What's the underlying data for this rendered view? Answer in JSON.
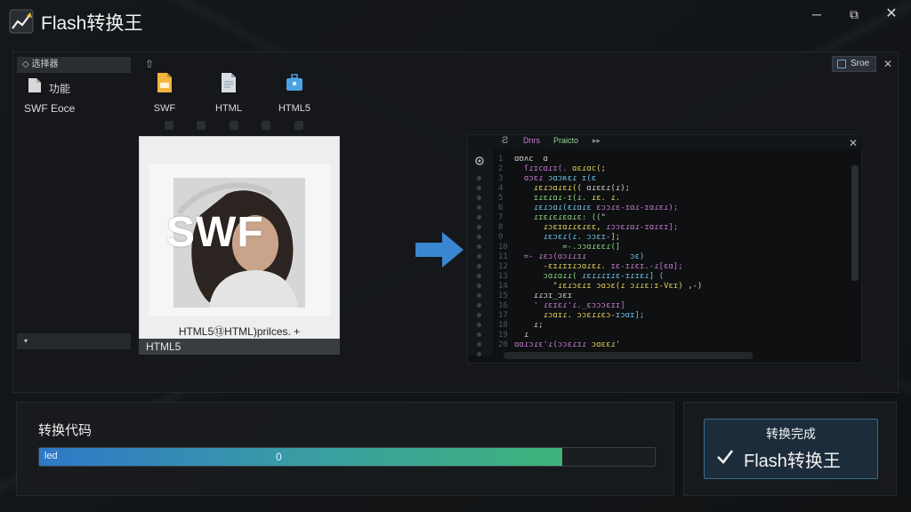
{
  "window": {
    "title": "Flash转换王",
    "controls": {
      "minimize": "─",
      "maximize": "⧉",
      "close": "✕"
    }
  },
  "sidebar": {
    "header": "◇ 选择器",
    "items": [
      {
        "label": "功能",
        "icon": "file-icon"
      },
      {
        "label": "SWF Eoce"
      }
    ],
    "collapse_label": "▾"
  },
  "toolbar": {
    "up_icon": "⇧",
    "formats": [
      {
        "label": "SWF",
        "icon": "swf-file-icon",
        "color": "#e8a23a"
      },
      {
        "label": "HTML",
        "icon": "html-file-icon",
        "color": "#cfd6df"
      },
      {
        "label": "HTML5",
        "icon": "html5-briefcase-icon",
        "color": "#4aa3e0"
      }
    ],
    "save_label": "Sroe",
    "close": "✕"
  },
  "preview": {
    "overlay_text": "SWF",
    "caption": "HTML5⑬HTML)prilces. +",
    "footer": "HTML5"
  },
  "code_editor": {
    "tabs": [
      "Ƨ",
      "Dnrs",
      "Praicto",
      "▸▸"
    ],
    "close": "✕"
  },
  "progress": {
    "label": "转换代码",
    "left_text": "led",
    "mid_text": "0",
    "fraction": 0.85,
    "colors": {
      "start": "#2f78c8",
      "end": "#3fb37a"
    }
  },
  "status": {
    "title": "转换完成",
    "main": "Flash转换王",
    "accent": "#3b6c8e"
  }
}
